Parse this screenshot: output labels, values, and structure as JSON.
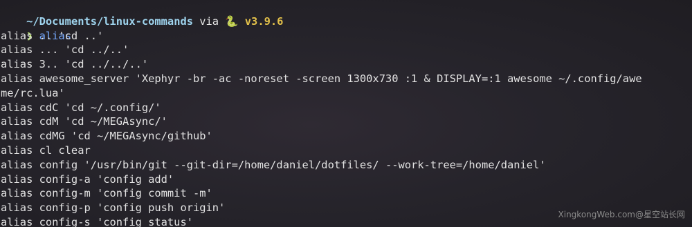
{
  "prompt": {
    "path": "~/Documents/linux-commands",
    "via": " via ",
    "python_icon": "🐍",
    "python_version": " v3.9.6",
    "symbol": "❯",
    "command": "alias"
  },
  "output_lines": [
    "alias .. 'cd ..'",
    "alias ... 'cd ../..'",
    "alias 3.. 'cd ../../..'",
    "alias awesome_server 'Xephyr -br -ac -noreset -screen 1300x730 :1 & DISPLAY=:1 awesome ~/.config/awe",
    "me/rc.lua'",
    "alias cdC 'cd ~/.config/'",
    "alias cdM 'cd ~/MEGAsync/'",
    "alias cdMG 'cd ~/MEGAsync/github'",
    "alias cl clear",
    "alias config '/usr/bin/git --git-dir=/home/daniel/dotfiles/ --work-tree=/home/daniel'",
    "alias config-a 'config add'",
    "alias config-m 'config commit -m'",
    "alias config-p 'config push origin'",
    "alias config-s 'config status'"
  ],
  "watermark": "XingkongWeb.com@星空站长网",
  "colors": {
    "path": "#9fd4ee",
    "python": "#e3c14a",
    "prompt_symbol": "#b8e36a",
    "command": "#76a9ff"
  }
}
